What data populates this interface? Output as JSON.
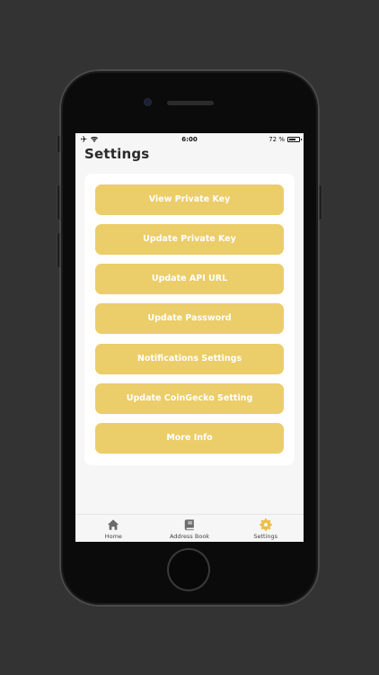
{
  "status_bar": {
    "time": "6:00",
    "battery_text": "72 %",
    "battery_level": 0.72,
    "left_icons": [
      "airplane-icon",
      "wifi-icon"
    ]
  },
  "header": {
    "title": "Settings"
  },
  "settings_menu": {
    "items": [
      {
        "label": "View Private Key"
      },
      {
        "label": "Update Private Key"
      },
      {
        "label": "Update API URL"
      },
      {
        "label": "Update Password"
      },
      {
        "label": "Notifications Settings"
      },
      {
        "label": "Update CoinGecko Setting"
      },
      {
        "label": "More Info"
      }
    ]
  },
  "tab_bar": {
    "tabs": [
      {
        "label": "Home",
        "icon": "home-icon",
        "active": false
      },
      {
        "label": "Address Book",
        "icon": "book-icon",
        "active": false
      },
      {
        "label": "Settings",
        "icon": "gear-icon",
        "active": true
      }
    ]
  },
  "colors": {
    "accent": "#ebcd6a",
    "button_text": "#ffffff",
    "screen_bg": "#f6f6f6",
    "card_bg": "#ffffff",
    "tab_icon": "#6b6b6b",
    "tab_icon_active": "#ebc04a",
    "page_bg": "#333333"
  }
}
